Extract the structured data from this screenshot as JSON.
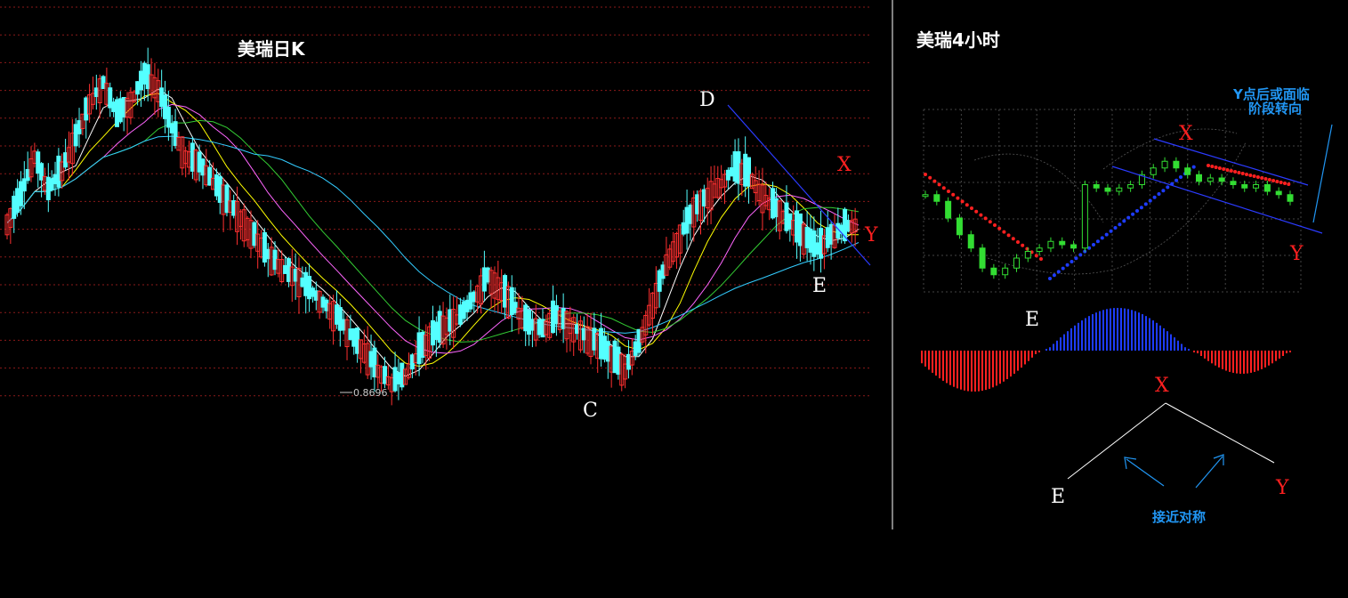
{
  "left_chart": {
    "title": "美瑞日K",
    "low_label": "0.8696",
    "points": {
      "D": "D",
      "X": "X",
      "Y": "Y",
      "E": "E",
      "C": "C"
    }
  },
  "right_chart": {
    "title": "美瑞4小时",
    "note_line1": "Y点后或面临",
    "note_line2": "阶段转向",
    "points": {
      "X": "X",
      "E": "E",
      "Y": "Y"
    },
    "diagram": {
      "X": "X",
      "E": "E",
      "Y": "Y",
      "caption": "接近对称"
    }
  },
  "colors": {
    "up_candle": "#ff3030",
    "down_candle": "#54ffff",
    "grid": "#8b1a1a",
    "ma5": "#ffffff",
    "ma10": "#ffff00",
    "ma20": "#ff66ff",
    "ma30": "#33cc33",
    "ma60": "#33ccff",
    "trendline": "#2b3bff",
    "accent_blue": "#2196f3",
    "accent_red": "#ff2020"
  },
  "chart_data": [
    {
      "type": "candlestick",
      "title": "美瑞日K",
      "series": [
        {
          "name": "close",
          "values": [
            1.5,
            1.6,
            1.75,
            1.62,
            1.7,
            1.82,
            1.95,
            2.02,
            1.9,
            1.95,
            2.05,
            2.0,
            1.85,
            1.75,
            1.72,
            1.65,
            1.58,
            1.52,
            1.45,
            1.38,
            1.33,
            1.3,
            1.25,
            1.2,
            1.15,
            1.08,
            1.02,
            0.95,
            0.9,
            0.93,
            1.02,
            1.08,
            1.12,
            1.15,
            1.22,
            1.3,
            1.25,
            1.18,
            1.12,
            1.1,
            1.15,
            1.12,
            1.08,
            1.05,
            1.0,
            0.95,
            1.05,
            1.2,
            1.35,
            1.45,
            1.55,
            1.6,
            1.65,
            1.7,
            1.68,
            1.6,
            1.55,
            1.5,
            1.45,
            1.4,
            1.45,
            1.48,
            1.5
          ]
        }
      ],
      "annotations": [
        "D",
        "X",
        "Y",
        "E",
        "C",
        "0.8696"
      ]
    },
    {
      "type": "candlestick",
      "title": "美瑞4小时",
      "series": [
        {
          "name": "close",
          "values": [
            1.52,
            1.5,
            1.45,
            1.4,
            1.36,
            1.3,
            1.28,
            1.3,
            1.33,
            1.35,
            1.36,
            1.38,
            1.37,
            1.36,
            1.55,
            1.54,
            1.53,
            1.54,
            1.55,
            1.58,
            1.6,
            1.62,
            1.6,
            1.58,
            1.56,
            1.57,
            1.56,
            1.55,
            1.54,
            1.55,
            1.53,
            1.52,
            1.5
          ]
        }
      ],
      "annotations": [
        "X",
        "E",
        "Y"
      ]
    }
  ]
}
